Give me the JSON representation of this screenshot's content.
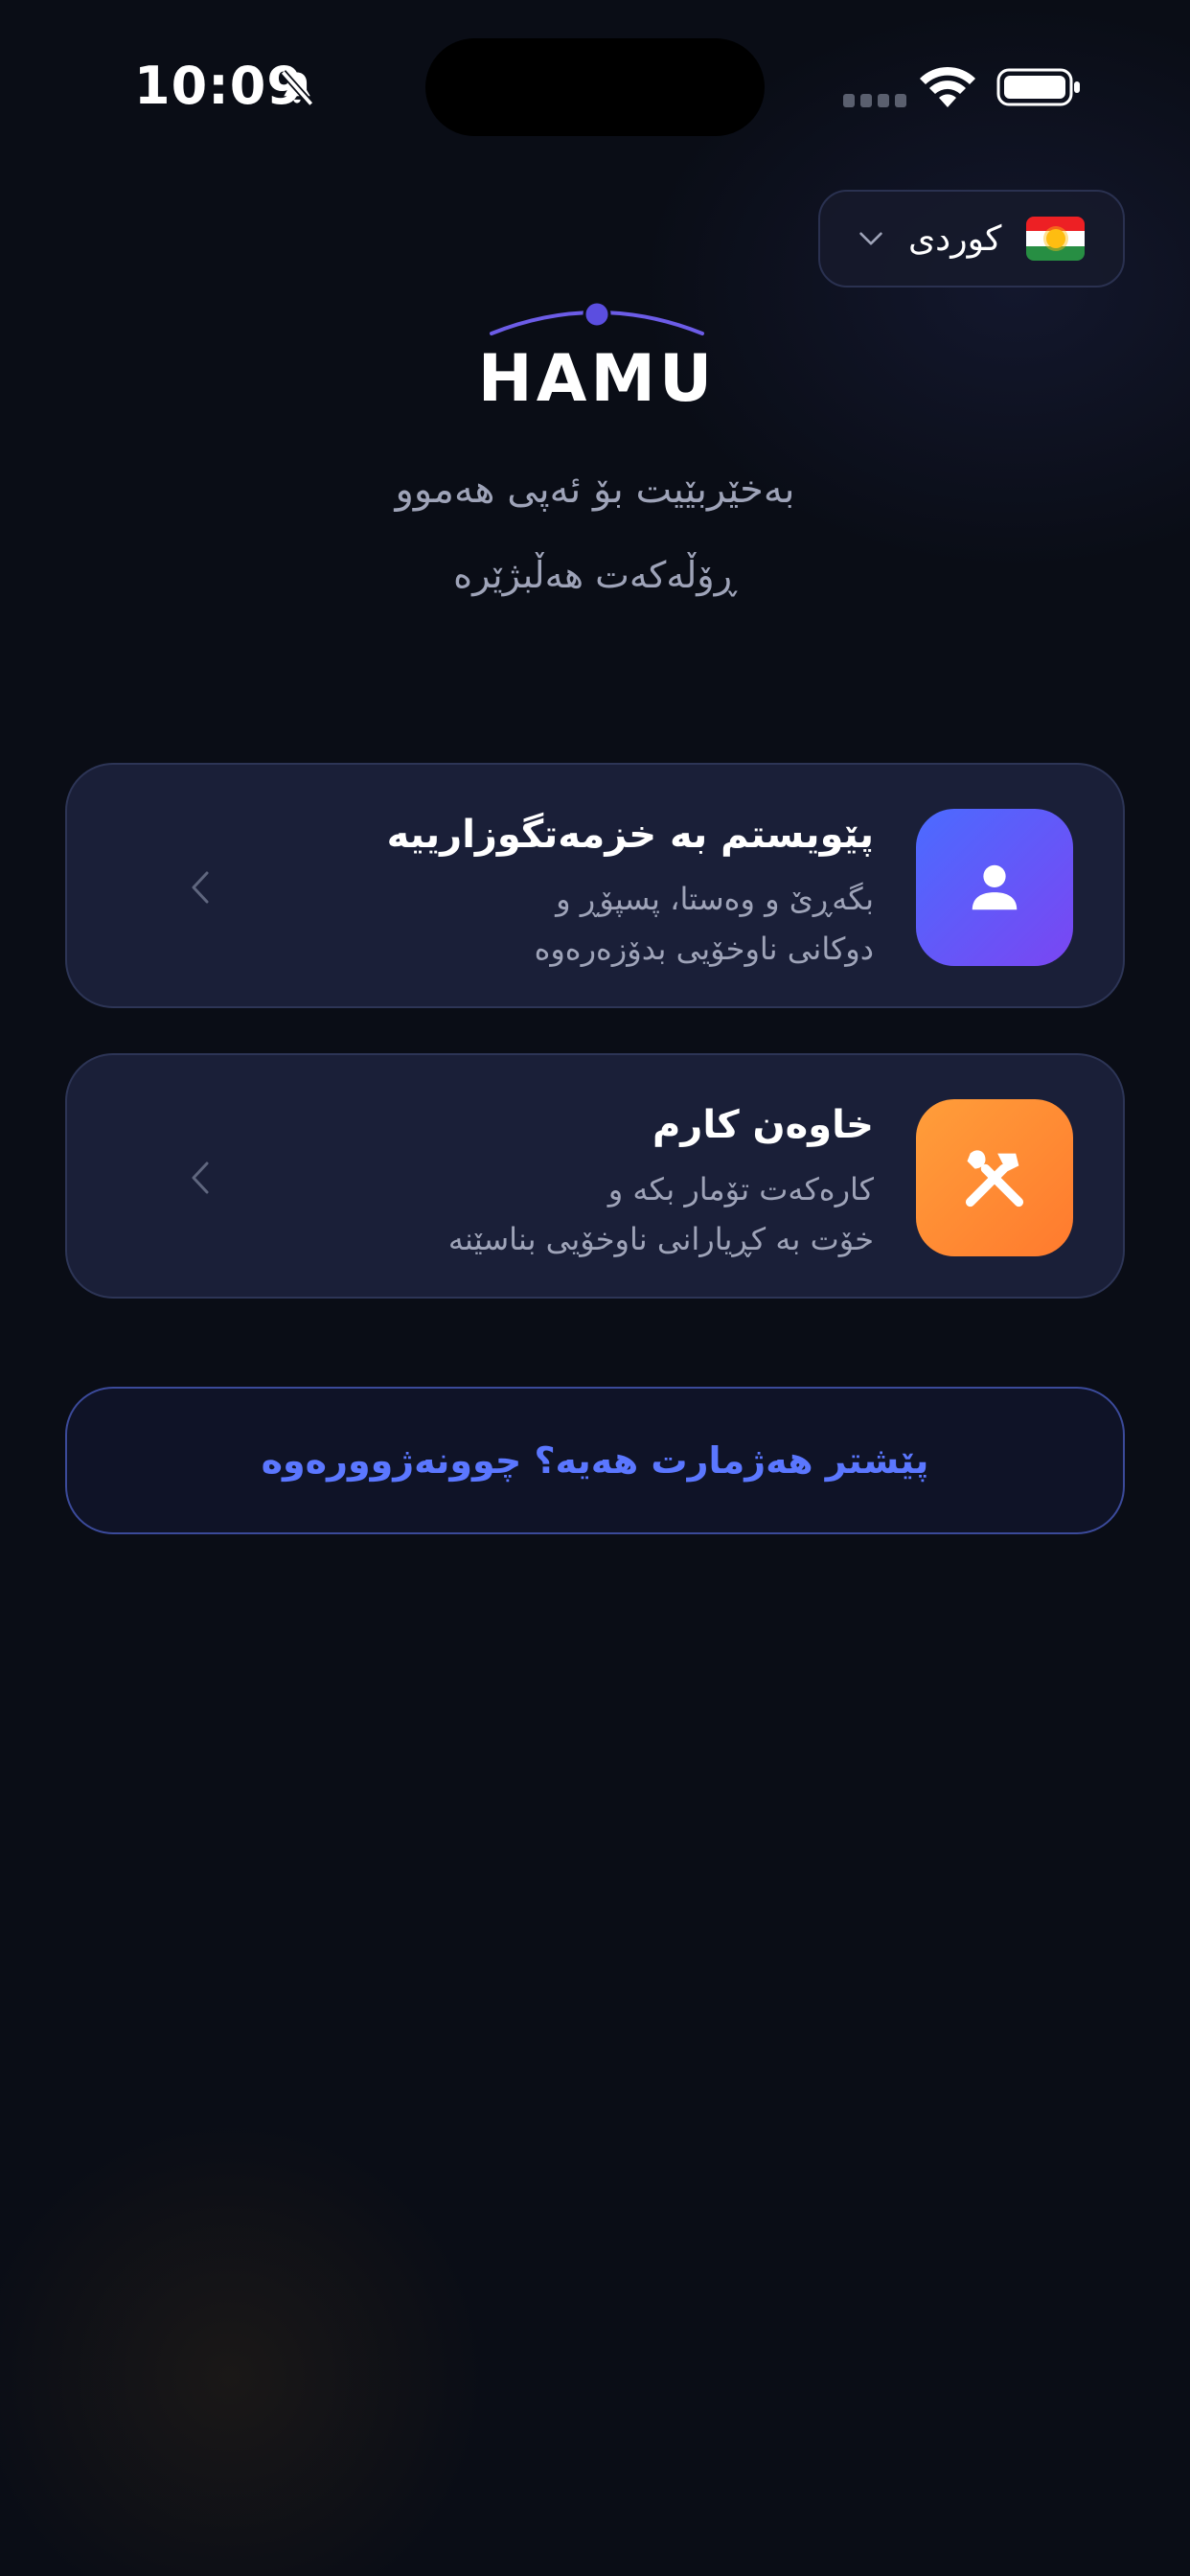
{
  "status_bar": {
    "time": "10:09",
    "icons": [
      "bell-slash-icon",
      "cellular-signal-icon",
      "wifi-icon",
      "battery-icon"
    ]
  },
  "language_selector": {
    "label": "کوردی",
    "flag": "kurdistan-flag-icon",
    "chevron": "chevron-down-icon"
  },
  "logo": {
    "text": "HAMU",
    "accent": "#6c5ce7"
  },
  "welcome_text": "بەخێربێیت بۆ ئەپی هەموو",
  "choose_role_text": "ڕۆڵەکەت هەڵبژێرە",
  "roles": [
    {
      "title": "پێویستم بە خزمەتگوزارییە",
      "description_line1": "بگەڕێ و وەستا، پسپۆڕ و",
      "description_line2": "دوکانی ناوخۆیی بدۆزەرەوە",
      "icon": "user-icon",
      "color": "#5b5ff5"
    },
    {
      "title": "خاوەن کارم",
      "description_line1": "کارەکەت تۆمار بکە و",
      "description_line2": "خۆت بە کڕیارانی ناوخۆیی بناسێنە",
      "icon": "tools-icon",
      "color": "#ff8c33"
    }
  ],
  "login_button": {
    "label": "پێشتر هەژمارت هەیە؟ چوونەژوورەوە",
    "color": "#5b77ff"
  }
}
